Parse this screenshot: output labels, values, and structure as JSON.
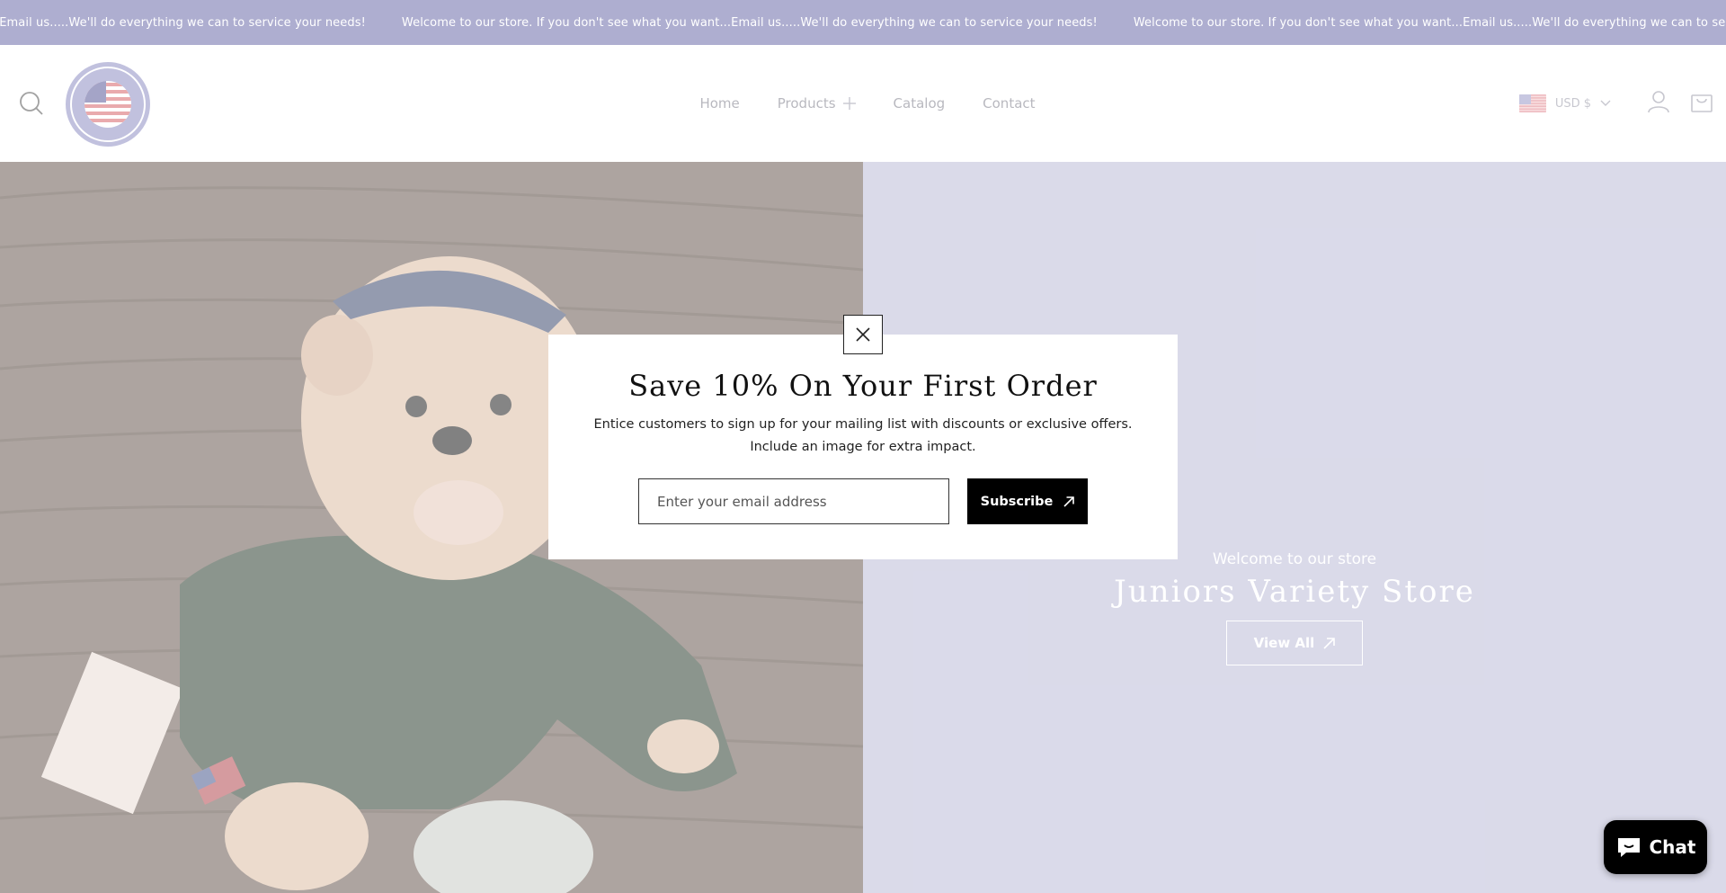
{
  "announcement": {
    "messages": [
      "Welcome to our store. If you don't see what you want...Email us.....We'll do everything we can to service your needs!",
      "Welcome to our store. If you don't see what you want...Email us.....We'll do everything we can to service your needs!",
      "Welcome to our store. If you don't see what you want...Email us.....We'll do everything we can to service your needs!"
    ]
  },
  "header": {
    "logo_alt": "JUNIORS VARIETY STORE",
    "nav": [
      {
        "label": "Home"
      },
      {
        "label": "Products"
      },
      {
        "label": "Catalog"
      },
      {
        "label": "Contact"
      }
    ],
    "currency": "USD $"
  },
  "hero": {
    "kicker": "Welcome to our store",
    "title": "Juniors Variety Store",
    "button_label": "View All"
  },
  "popup": {
    "title": "Save 10% On Your First Order",
    "body_line1": "Entice customers to sign up for your mailing list with discounts or exclusive offers.",
    "body_line2": "Include an image for extra impact.",
    "email_placeholder": "Enter your email address",
    "subscribe_label": "Subscribe"
  },
  "chat": {
    "label": "Chat"
  },
  "colors": {
    "announce_bg": "#aeaed0",
    "hero_right_bg": "#bcbcd8",
    "accent": "#8f8fc4"
  },
  "icons": [
    "search-icon",
    "logo",
    "plus-icon",
    "us-flag-icon",
    "chevron-down-icon",
    "account-icon",
    "cart-icon",
    "close-icon",
    "arrow-up-right-icon",
    "chat-bubble-icon"
  ]
}
